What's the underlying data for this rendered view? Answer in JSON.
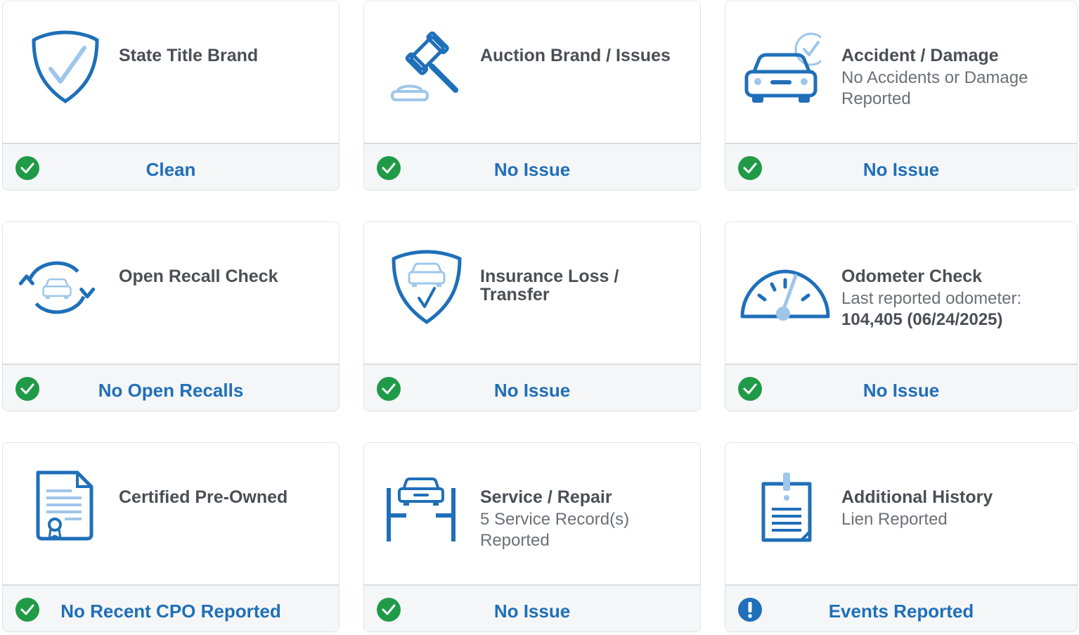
{
  "colors": {
    "accent_blue": "#1f6fb9",
    "light_blue": "#9ec6ea",
    "check_green": "#1f9a47",
    "alert_blue": "#1f6fb9",
    "title_text": "#4a4f55",
    "sub_text": "#6b7077"
  },
  "cards": [
    {
      "title": "State Title Brand",
      "subtitle": "",
      "subtitle_strong": "",
      "icon": "shield-check-icon",
      "status_icon": "check-circle-icon",
      "status": "Clean"
    },
    {
      "title": "Auction Brand / Issues",
      "subtitle": "",
      "subtitle_strong": "",
      "icon": "gavel-icon",
      "status_icon": "check-circle-icon",
      "status": "No Issue"
    },
    {
      "title": "Accident / Damage",
      "subtitle": "No Accidents or Damage Reported",
      "subtitle_strong": "",
      "icon": "car-check-icon",
      "status_icon": "check-circle-icon",
      "status": "No Issue"
    },
    {
      "title": "Open Recall Check",
      "subtitle": "",
      "subtitle_strong": "",
      "icon": "car-recall-icon",
      "status_icon": "check-circle-icon",
      "status": "No Open Recalls"
    },
    {
      "title": "Insurance Loss / Transfer",
      "subtitle": "",
      "subtitle_strong": "",
      "icon": "shield-car-icon",
      "status_icon": "check-circle-icon",
      "status": "No Issue"
    },
    {
      "title": "Odometer Check",
      "subtitle": "Last reported odometer:",
      "subtitle_strong": "104,405 (06/24/2025)",
      "icon": "odometer-icon",
      "status_icon": "check-circle-icon",
      "status": "No Issue"
    },
    {
      "title": "Certified Pre-Owned",
      "subtitle": "",
      "subtitle_strong": "",
      "icon": "certificate-icon",
      "status_icon": "check-circle-icon",
      "status": "No Recent CPO Reported"
    },
    {
      "title": "Service / Repair",
      "subtitle": "5 Service Record(s) Reported",
      "subtitle_strong": "",
      "icon": "car-lift-icon",
      "status_icon": "check-circle-icon",
      "status": "No Issue"
    },
    {
      "title": "Additional History",
      "subtitle": "Lien Reported",
      "subtitle_strong": "",
      "icon": "clipboard-alert-icon",
      "status_icon": "exclamation-circle-icon",
      "status": "Events Reported"
    }
  ]
}
